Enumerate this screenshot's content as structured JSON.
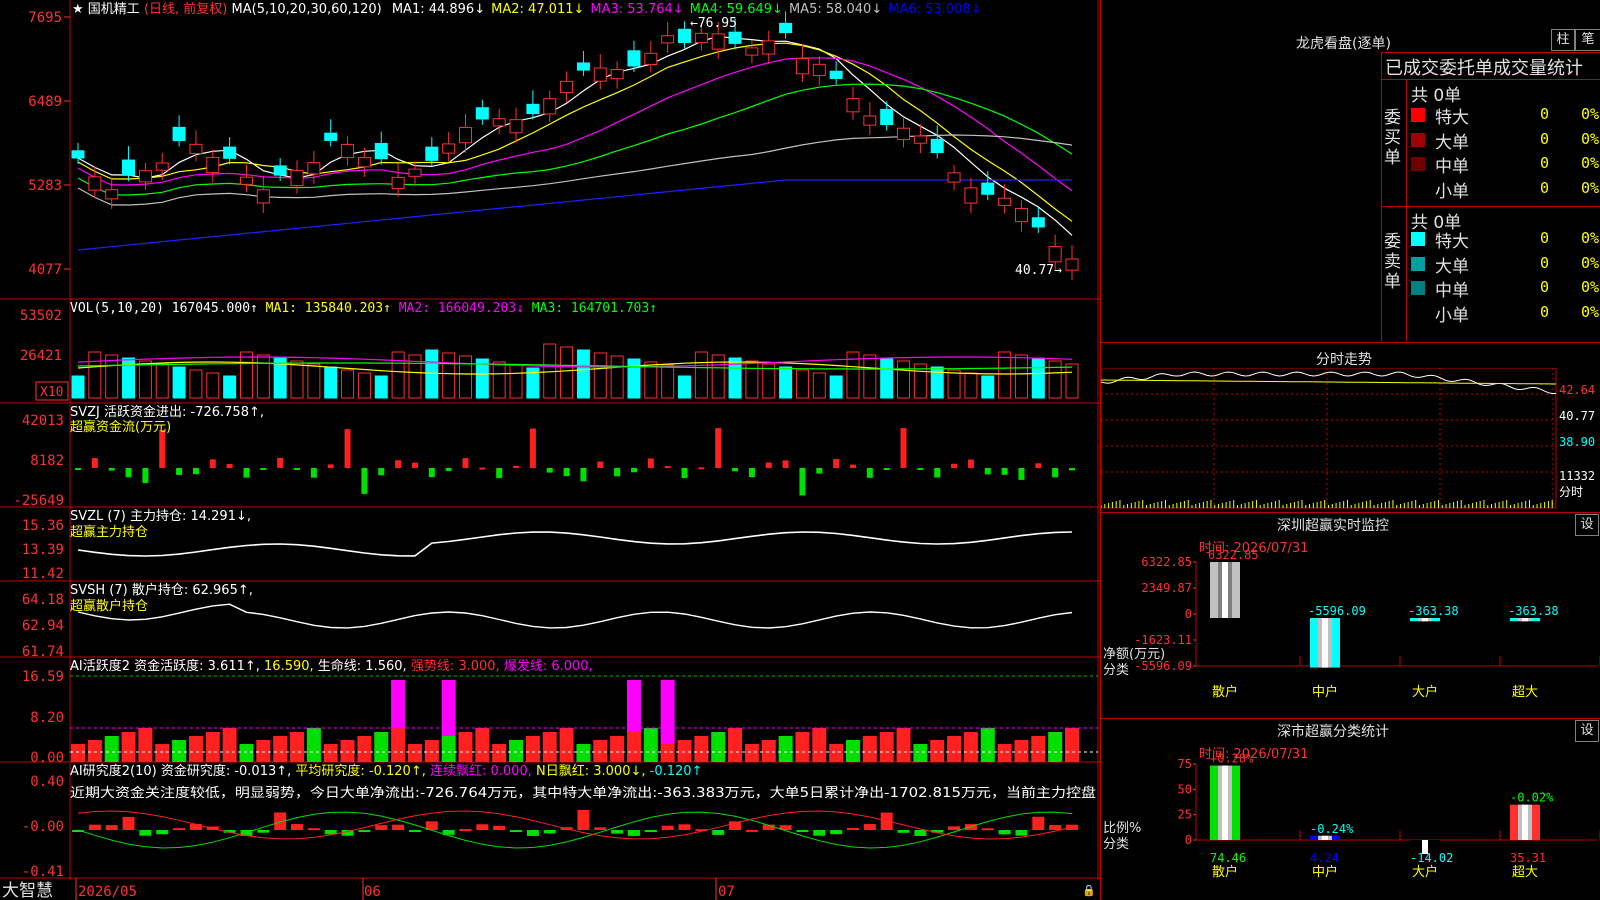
{
  "stock": {
    "name": "国机精工",
    "mode": "(日线, 前复权)",
    "ma_header": "MA(5,10,20,30,60,120)",
    "ma": [
      {
        "label": "MA1: 44.896↓",
        "color": "#ffffff"
      },
      {
        "label": "MA2: 47.011↓",
        "color": "#ffff00"
      },
      {
        "label": "MA3: 53.764↓",
        "color": "#ff00ff"
      },
      {
        "label": "MA4: 59.649↓",
        "color": "#00ff00"
      },
      {
        "label": "MA5: 58.040↓",
        "color": "#c0c0c0"
      },
      {
        "label": "MA6: 53.008↓",
        "color": "#0000ff"
      }
    ],
    "price_ticks": [
      "7695",
      "6489",
      "5283",
      "4077"
    ],
    "high_label": "76.95",
    "low_label": "40.77"
  },
  "vol": {
    "header": "VOL(5,10,20)",
    "value": "167045.000↑",
    "ma1": "MA1: 135840.203↑",
    "ma2": "MA2: 166049.203↓",
    "ma3": "MA3: 164701.703↑",
    "ticks": [
      "53502",
      "26421"
    ],
    "unit": "X10"
  },
  "svzj": {
    "header": "SVZJ  活跃资金进出: -726.758↑,",
    "sub": "超赢资金流(万元)",
    "ticks": [
      "42013",
      "8182",
      "-25649"
    ]
  },
  "svzl": {
    "header": "SVZL (7) 主力持仓: 14.291↓,",
    "sub": "超赢主力持仓",
    "ticks": [
      "15.36",
      "13.39",
      "11.42"
    ]
  },
  "svsh": {
    "header": "SVSH (7) 散户持仓: 62.965↑,",
    "sub": "超赢散户持仓",
    "ticks": [
      "64.18",
      "62.94",
      "61.74"
    ]
  },
  "ai1": {
    "h1": "AI活跃度2 资金活跃度: 3.611↑,",
    "h2": "16.590,",
    "h3": "生命线: 1.560,",
    "h4": "强势线: 3.000,",
    "h5": "爆发线: 6.000,",
    "ticks": [
      "16.59",
      "8.20",
      "0.00"
    ]
  },
  "ai2": {
    "h1": "AI研究度2(10) 资金研究度: -0.013↑,",
    "h2": "平均研究度: -0.120↑,",
    "h3": "连续飘红: 0.000,",
    "h4": "N日飘红: 3.000↓,",
    "h5": "-0.120↑",
    "note": "近期大资金关注度较低，明显弱势，今日大单净流出:-726.764万元，其中特大单净流出:-363.383万元，大单5日累计净出-1702.815万元，当前主力控盘",
    "ticks": [
      "0.40",
      "-0.00",
      "-0.41"
    ]
  },
  "xaxis": {
    "brand": "大智慧",
    "labels": [
      "2026/05",
      "06",
      "07"
    ]
  },
  "dragon": {
    "title": "龙虎看盘(逐单)",
    "btn1": "柱",
    "btn2": "笔",
    "tabs": "已成交委托单成交量统计",
    "buy_side": "委买单",
    "sell_side": "委卖单",
    "buy_total": "共 0单",
    "sell_total": "共 0单",
    "rows": [
      {
        "label": "特大",
        "count": "0",
        "pct": "0%"
      },
      {
        "label": "大单",
        "count": "0",
        "pct": "0%"
      },
      {
        "label": "中单",
        "count": "0",
        "pct": "0%"
      },
      {
        "label": "小单",
        "count": "0",
        "pct": "0%"
      }
    ],
    "buy_colors": [
      "#ff0000",
      "#a00000",
      "#700000",
      "#000000"
    ],
    "sell_colors": [
      "#00ffff",
      "#00a0a0",
      "#008080",
      "#000000"
    ]
  },
  "intraday": {
    "title": "分时走势",
    "ticks": [
      "42.64",
      "40.77",
      "38.90"
    ],
    "vol": "11332",
    "vol_unit": "分时"
  },
  "sz_monitor": {
    "title": "深圳超赢实时监控",
    "btn": "设",
    "date": "时间: 2026/07/31",
    "ticks": [
      "6322.85",
      "2349.87",
      "0",
      "-1623.11",
      "-5596.09"
    ],
    "ylabel": "净额(万元)",
    "xlabel": "分类",
    "cats": [
      "散户",
      "中户",
      "大户",
      "超大"
    ],
    "values": [
      6322.85,
      -5596.09,
      -363.38,
      -363.38
    ],
    "value_labels": [
      "6322.85",
      "-5596.09",
      "-363.38",
      "-363.38"
    ]
  },
  "sz_class": {
    "title": "深市超赢分类统计",
    "btn": "设",
    "date": "时间: 2026/07/31",
    "ticks": [
      "75",
      "50",
      "25",
      "0"
    ],
    "ylabel": "比例%",
    "xlabel": "分类",
    "cats": [
      "散户",
      "中户",
      "大户",
      "超大"
    ],
    "values": [
      74.46,
      4.24,
      -14.02,
      35.31
    ],
    "top_labels": [
      "+0.28%",
      "-0.24%",
      "",
      "-0.02%"
    ],
    "bottom_labels": [
      "74.46",
      "4.24",
      "-14.02",
      "35.31"
    ]
  }
}
